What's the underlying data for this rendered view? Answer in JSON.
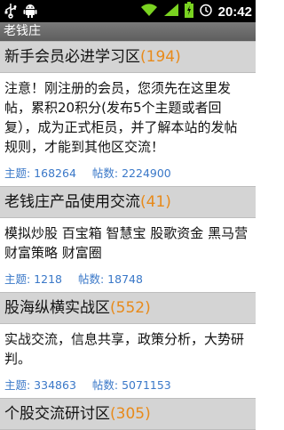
{
  "status_bar": {
    "time": "20:42",
    "icons": [
      "usb-icon",
      "android-debug-icon",
      "wifi-icon",
      "signal-icon",
      "battery-icon",
      "alarm-icon"
    ]
  },
  "app": {
    "title": "老钱庄"
  },
  "sections": [
    {
      "title": "新手会员必进学习区",
      "count": "(194)",
      "description": "注意！刚注册的会员，您须先在这里发帖，累积20积分(发布5个主题或者回复），成为正式柜员，并了解本站的发帖规则，才能到其他区交流！",
      "topics": "主题: 168264",
      "posts": "帖数: 2224900"
    },
    {
      "title": "老钱庄产品使用交流",
      "count": "(41)",
      "description": "模拟炒股 百宝箱 智慧宝 股歌资金 黑马营 财富策略 财富圈",
      "topics": "主题: 1218",
      "posts": "帖数: 18748"
    },
    {
      "title": "股海纵横实战区",
      "count": "(552)",
      "description": "实战交流，信息共享，政策分析，大势研判。",
      "topics": "主题: 334863",
      "posts": "帖数: 5071153"
    },
    {
      "title": "个股交流研讨区",
      "count": "(305)",
      "description": "",
      "topics": "",
      "posts": ""
    }
  ],
  "colors": {
    "count": "#e88a1a",
    "stats": "#3a78c8",
    "header_bg": "#d4d4d4",
    "titlebar_bg": "#6b6b6b"
  }
}
